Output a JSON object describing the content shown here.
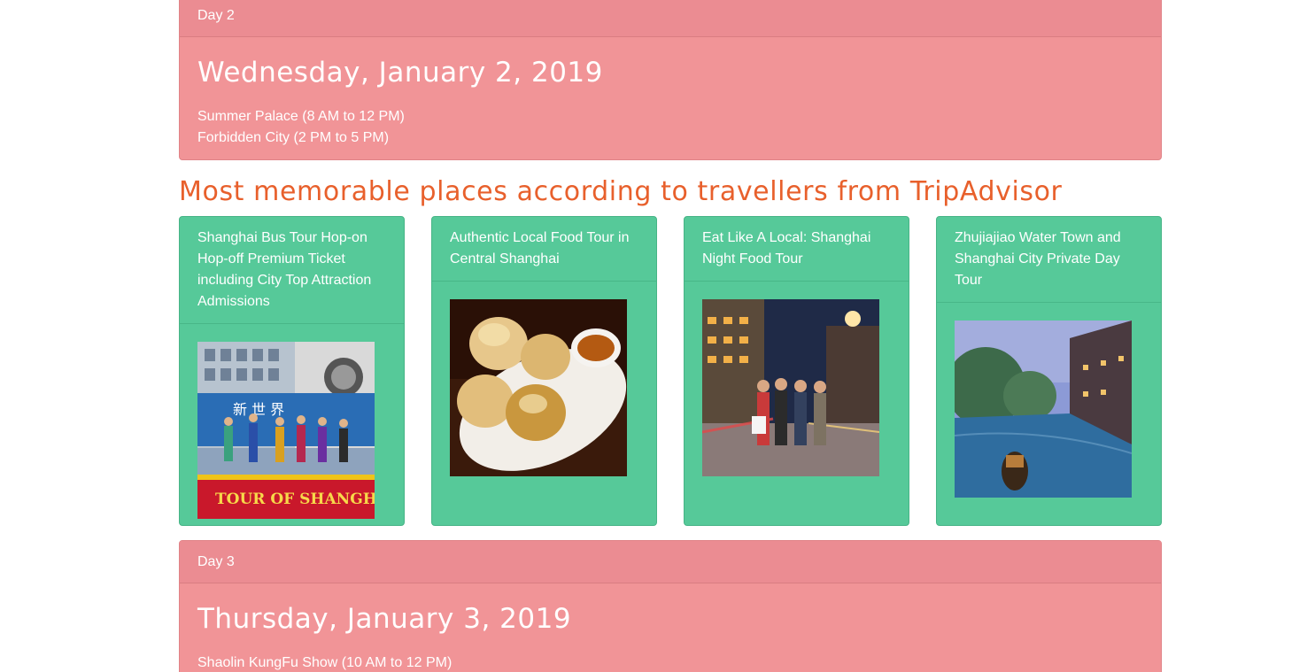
{
  "day2": {
    "heading": "Day 2",
    "date": "Wednesday, January 2, 2019",
    "activities": [
      "Summer Palace (8 AM to 12 PM)",
      "Forbidden City (2 PM to 5 PM)"
    ]
  },
  "section": {
    "title": "Most memorable places according to travellers from TripAdvisor"
  },
  "tours": [
    {
      "title": "Shanghai Bus Tour Hop-on Hop-off Premium Ticket including City Top Attraction Admissions",
      "image": "shanghai-bus-tour-photo"
    },
    {
      "title": "Authentic Local Food Tour in Central Shanghai",
      "image": "dumplings-photo"
    },
    {
      "title": "Eat Like A Local: Shanghai Night Food Tour",
      "image": "night-street-group-photo"
    },
    {
      "title": "Zhujiajiao Water Town and Shanghai City Private Day Tour",
      "image": "water-town-canal-photo"
    }
  ],
  "day3": {
    "heading": "Day 3",
    "date": "Thursday, January 3, 2019",
    "activities": [
      "Shaolin KungFu Show (10 AM to 12 PM)"
    ]
  },
  "colors": {
    "day_panel": "#f19497",
    "card": "#56c999",
    "section_title": "#e8602c"
  }
}
